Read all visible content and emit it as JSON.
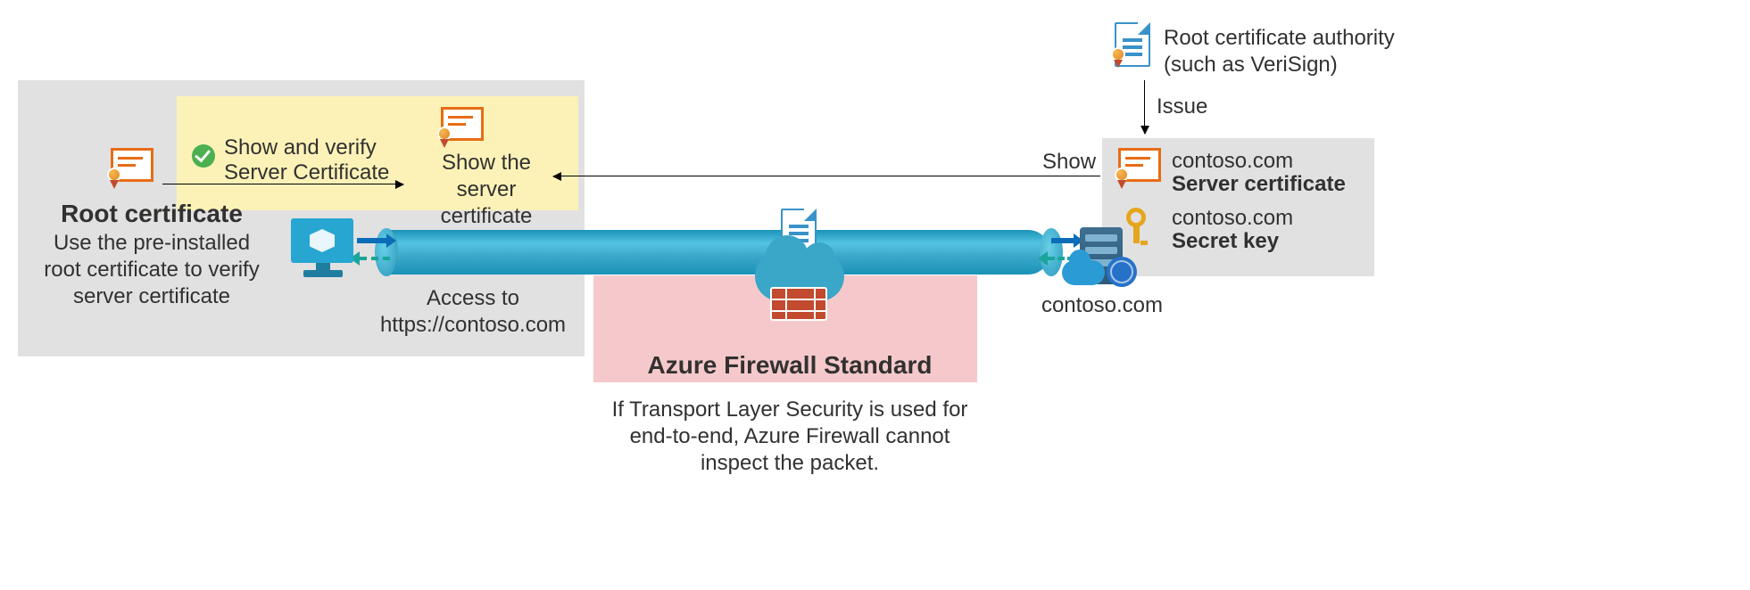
{
  "left_panel": {
    "root_cert_title": "Root certificate",
    "root_cert_desc_line1": "Use the pre-installed",
    "root_cert_desc_line2": "root certificate to verify",
    "root_cert_desc_line3": "server certificate",
    "verify_text_line1": "Show and verify",
    "verify_text_line2": "Server Certificate",
    "show_server_line1": "Show the server",
    "show_server_line2": "certificate",
    "access_line1": "Access to",
    "access_line2": "https://contoso.com"
  },
  "show_arrow_label": "Show",
  "firewall": {
    "title": "Azure Firewall Standard",
    "note_line1": "If Transport Layer Security is used for",
    "note_line2": "end-to-end, Azure Firewall cannot",
    "note_line3": "inspect the packet."
  },
  "server_label": "contoso.com",
  "right_panel": {
    "domain1": "contoso.com",
    "server_cert_label": "Server certificate",
    "domain2": "contoso.com",
    "secret_key_label": "Secret key"
  },
  "root_ca": {
    "line1": "Root certificate authority",
    "line2": "(such as VeriSign)",
    "issue_label": "Issue"
  }
}
